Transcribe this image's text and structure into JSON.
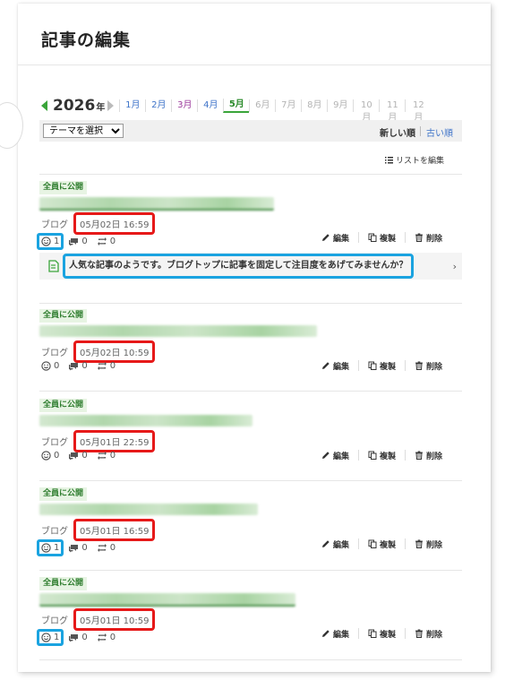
{
  "page": {
    "title": "記事の編集"
  },
  "year_nav": {
    "year": "2026",
    "year_unit": "年",
    "months": [
      {
        "label": "1月",
        "state": "link"
      },
      {
        "label": "2月",
        "state": "link"
      },
      {
        "label": "3月",
        "state": "purple"
      },
      {
        "label": "4月",
        "state": "link"
      },
      {
        "label": "5月",
        "state": "active"
      },
      {
        "label": "6月",
        "state": "dim"
      },
      {
        "label": "7月",
        "state": "dim"
      },
      {
        "label": "8月",
        "state": "dim"
      },
      {
        "label": "9月",
        "state": "dim"
      },
      {
        "label": "10月",
        "state": "dim"
      },
      {
        "label": "11月",
        "state": "dim"
      },
      {
        "label": "12月",
        "state": "dim"
      }
    ]
  },
  "filter": {
    "theme_select": "テーマを選択",
    "sort_new": "新しい順",
    "sort_old": "古い順"
  },
  "list_edit_label": "リストを編集",
  "actions": {
    "edit": "編集",
    "copy": "複製",
    "delete": "削除"
  },
  "tip": {
    "text": "人気な記事のようです。ブログトップに記事を固定して注目度をあげてみませんか？"
  },
  "entries": [
    {
      "badge": "全員に公開",
      "category": "ブログ",
      "date": "05月02日 16:59",
      "likes": "1",
      "comments": "0",
      "reblogs": "0"
    },
    {
      "badge": "全員に公開",
      "category": "ブログ",
      "date": "05月02日 10:59",
      "likes": "0",
      "comments": "0",
      "reblogs": "0"
    },
    {
      "badge": "全員に公開",
      "category": "ブログ",
      "date": "05月01日 22:59",
      "likes": "0",
      "comments": "0",
      "reblogs": "0"
    },
    {
      "badge": "全員に公開",
      "category": "ブログ",
      "date": "05月01日 16:59",
      "likes": "1",
      "comments": "0",
      "reblogs": "0"
    },
    {
      "badge": "全員に公開",
      "category": "ブログ",
      "date": "05月01日 10:59",
      "likes": "1",
      "comments": "0",
      "reblogs": "0"
    }
  ],
  "colors": {
    "accent_green": "#3aa53a",
    "link_blue": "#3f74c9",
    "highlight_red": "#e61919",
    "highlight_blue": "#1aa3e0"
  }
}
